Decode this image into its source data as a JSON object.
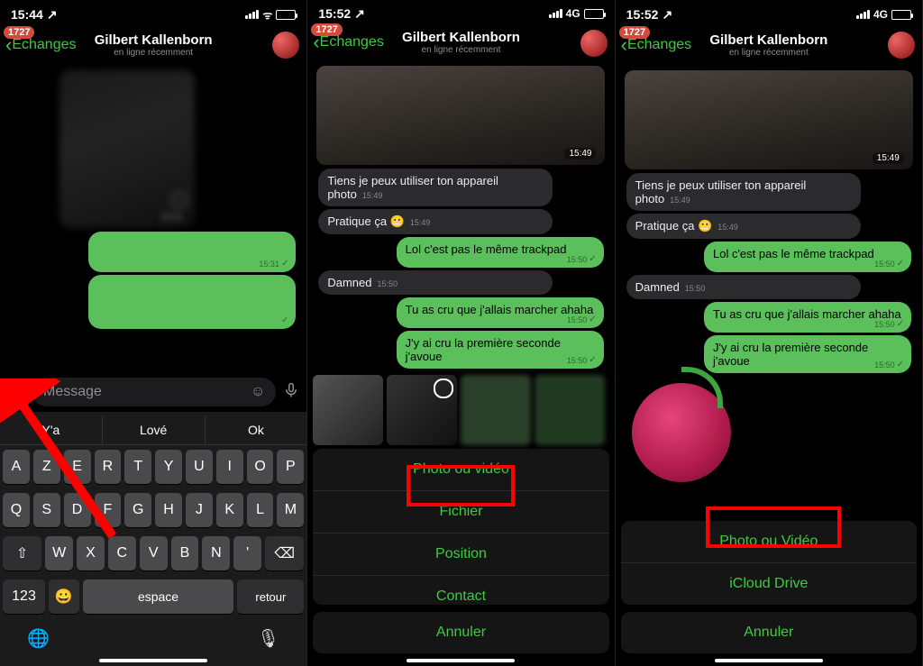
{
  "screens": [
    {
      "status": {
        "time": "15:44",
        "net": "",
        "loc": "↗"
      },
      "nav": {
        "badge": "1727",
        "back": "Echanges",
        "name": "Gilbert Kallenborn",
        "sub": "en ligne récemment"
      },
      "image_time": "15:31",
      "sent_times": [
        "15:31",
        ""
      ],
      "input": {
        "placeholder": "Message"
      },
      "suggestions": [
        "Y'a",
        "Lové",
        "Ok"
      ],
      "keyboard": {
        "row1": [
          "A",
          "Z",
          "E",
          "R",
          "T",
          "Y",
          "U",
          "I",
          "O",
          "P"
        ],
        "row2": [
          "Q",
          "S",
          "D",
          "F",
          "G",
          "H",
          "J",
          "K",
          "L",
          "M"
        ],
        "row3": [
          "⇧",
          "W",
          "X",
          "C",
          "V",
          "B",
          "N",
          "'",
          "⌫"
        ],
        "row4": {
          "num": "123",
          "emoji": "😀",
          "space": "espace",
          "ret": "retour"
        }
      }
    },
    {
      "status": {
        "time": "15:52",
        "net": "4G",
        "loc": "↗"
      },
      "nav": {
        "badge": "1727",
        "back": "Echanges",
        "name": "Gilbert Kallenborn",
        "sub": "en ligne récemment"
      },
      "photo_time": "15:49",
      "msgs": {
        "in1": "Tiens je peux utiliser ton appareil photo",
        "in1t": "15:49",
        "in2": "Pratique ça 😬",
        "in2t": "15:49",
        "out1": "Lol c'est pas le même trackpad",
        "out1t": "15:50",
        "in3": "Damned",
        "in3t": "15:50",
        "out2": "Tu as cru que j'allais marcher ahaha",
        "out2t": "15:50",
        "out3": "J'y ai cru la première seconde j'avoue",
        "out3t": "15:50"
      },
      "sheet": {
        "photo": "Photo ou vidéo",
        "file": "Fichier",
        "position": "Position",
        "contact": "Contact",
        "cancel": "Annuler"
      }
    },
    {
      "status": {
        "time": "15:52",
        "net": "4G",
        "loc": "↗"
      },
      "nav": {
        "badge": "1727",
        "back": "Echanges",
        "name": "Gilbert Kallenborn",
        "sub": "en ligne récemment"
      },
      "photo_time": "15:49",
      "msgs": {
        "in1": "Tiens je peux utiliser ton appareil photo",
        "in1t": "15:49",
        "in2": "Pratique ça 😬",
        "in2t": "15:49",
        "out1": "Lol c'est pas le même trackpad",
        "out1t": "15:50",
        "in3": "Damned",
        "in3t": "15:50",
        "out2": "Tu as cru que j'allais marcher ahaha",
        "out2t": "15:50",
        "out3": "J'y ai cru la première seconde j'avoue",
        "out3t": "15:50"
      },
      "sheet": {
        "photo": "Photo ou Vidéo",
        "icloud": "iCloud Drive",
        "cancel": "Annuler"
      }
    }
  ]
}
